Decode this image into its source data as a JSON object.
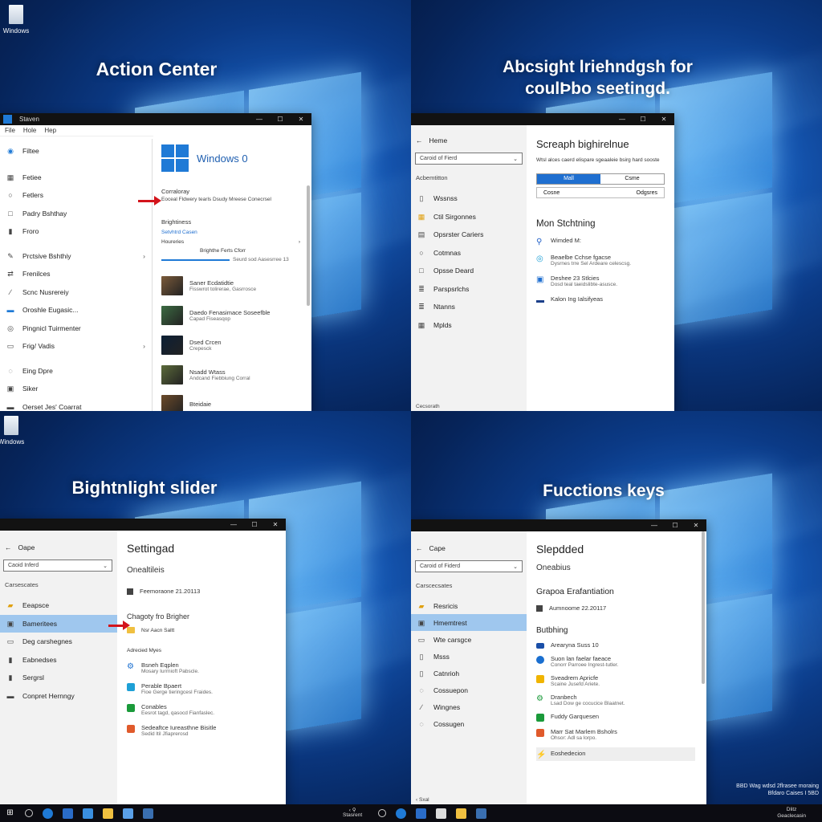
{
  "q1": {
    "title": "Action Center",
    "desktop_icon": "Windows",
    "window": {
      "title": "Staven",
      "menu": [
        "File",
        "Hole",
        "Hep"
      ],
      "left_items": [
        {
          "label": "Filtee",
          "icon": "circle-check-icon"
        },
        {
          "label": "Fetiee",
          "icon": "grid-icon"
        },
        {
          "label": "Fetlers",
          "icon": "circle-icon"
        },
        {
          "label": "Padry Bshthay",
          "icon": "square-icon"
        },
        {
          "label": "Froro",
          "icon": "bookmark-icon"
        },
        {
          "label": "Prctsive Bshthiy",
          "icon": "pen-icon",
          "chevron": "›"
        },
        {
          "label": "Frenilces",
          "icon": "link-icon"
        },
        {
          "label": "Scnc Nusrereiy",
          "icon": "wand-icon"
        },
        {
          "label": "Oroshle Eugasic...",
          "icon": "bar-icon"
        },
        {
          "label": "Pingnicl Tuirmenter",
          "icon": "target-icon"
        },
        {
          "label": "Frig/ Vadis",
          "icon": "display-icon",
          "chevron": "›"
        },
        {
          "label": "Eing Dpre",
          "icon": "circle-icon"
        },
        {
          "label": "Siker",
          "icon": "monitor-icon"
        },
        {
          "label": "Oerset Jes' Coarrat",
          "icon": "bar-icon"
        }
      ],
      "brand": "Windows 0",
      "group1_title": "Corraloray",
      "group1_sub": "Eoceal Fldwery tearls Dsudy Mreese Conecrsel",
      "group2_title": "Brightiness",
      "group2_link": "Setvhtrd Casen",
      "group2_sub": "Houreries",
      "slider_title": "Brighthe Ferts Cforr",
      "slider_value": "Seurd sod Aasesrree 13",
      "apps": [
        {
          "title": "Saner Ecdatidtie",
          "sub": "Fisswrot tolirerae, Gasrrosce",
          "color": "#7b5a3a"
        },
        {
          "title": "Daedo Fenasimace Soseefble",
          "sub": "Capad Fiseasqop",
          "color": "#3c6b42"
        },
        {
          "title": "Dsed Crcen",
          "sub": "Crepesck",
          "color": "#0c1f35"
        },
        {
          "title": "Nsadd Wtass",
          "sub": "Andcand Fiebbiung Corral",
          "color": "#5b6a3a"
        },
        {
          "title": "Bteidaie",
          "sub": "",
          "color": "#6b4a2a"
        }
      ]
    }
  },
  "q2": {
    "title_line1": "Abcsight lriehndgsh for",
    "title_line2": "coulÞbo seetingd.",
    "window": {
      "back": "Heme",
      "search_placeholder": "Caroid of Fierd",
      "section": "Acbemtitton",
      "left_items": [
        {
          "label": "Wssnss",
          "icon": "doc-icon"
        },
        {
          "label": "Ctil Sirgonnes",
          "icon": "color-grid-icon"
        },
        {
          "label": "Opsrster Cariers",
          "icon": "calc-icon"
        },
        {
          "label": "Cotmnas",
          "icon": "circle-icon"
        },
        {
          "label": "Opsse Deard",
          "icon": "square-icon"
        },
        {
          "label": "Parspsrlchs",
          "icon": "list-icon"
        },
        {
          "label": "Ntanns",
          "icon": "list-icon"
        },
        {
          "label": "Mplds",
          "icon": "grid-icon"
        }
      ],
      "bottom_label": "Cecsorath",
      "heading": "Screaph bighirelnue",
      "description": "Wtsl alces caerd elispare sgeaaleie bsirg hard sooste",
      "toggle_on": "Mall",
      "toggle_off": "Csme",
      "field_left": "Cosne",
      "field_right": "Odgsres",
      "heading2": "Mon Stchtning",
      "subitems": [
        {
          "title": "Wimded M:",
          "sub": "",
          "color": "#1f5fc7",
          "icon": "pin-icon"
        },
        {
          "title": "Beaelbe Cchse fgacse",
          "sub": "Dysrnes trre Sel Ardeare celescsg.",
          "color": "#1ea0d6",
          "icon": "circle-icon"
        },
        {
          "title": "Deshee 23 Stlcies",
          "sub": "Dosd teal taeidslibte-asusce.",
          "color": "#1f6fd0",
          "icon": "square-icon"
        },
        {
          "title": "Kalon Ing Ialsifyeas",
          "sub": "",
          "color": "#1b3f8a",
          "icon": "bar-icon"
        }
      ]
    }
  },
  "q3": {
    "title": "Bightnlight slider",
    "desktop_icon": "Windows",
    "window": {
      "back": "Oape",
      "search_placeholder": "Caoid Inferd",
      "section": "Carsescates",
      "left_items": [
        {
          "label": "Eeapsce",
          "icon": "folder-icon",
          "selected": false
        },
        {
          "label": "Bameritees",
          "icon": "monitor-icon",
          "selected": true
        },
        {
          "label": "Deg carshegnes",
          "icon": "display-icon",
          "selected": false
        },
        {
          "label": "Eabnedses",
          "icon": "bookmark-icon",
          "selected": false
        },
        {
          "label": "Sergrsl",
          "icon": "bookmark-icon",
          "selected": false
        },
        {
          "label": "Conpret Hernngy",
          "icon": "bar-icon",
          "selected": false
        }
      ],
      "heading": "Settingad",
      "subheading": "Onealtileis",
      "row1": "Feemoraone 21.20113",
      "group_title": "Chagoty fro Brigher",
      "group_sub": "Nsr Aacn Saltt",
      "section2": "Adrecied Myes",
      "subitems": [
        {
          "title": "Bsneh Eqplen",
          "sub": "Mosary Iurrnioft Pabscle.",
          "color": "#1a6fd0",
          "icon": "gear-icon"
        },
        {
          "title": "Perable Bpaert",
          "sub": "Fioe Gerge tieringcesl Fraides.",
          "color": "#1ea0d6",
          "icon": "square-icon"
        },
        {
          "title": "Conables",
          "sub": "Eesrot tagd, qasocd Fianfaslec.",
          "color": "#1a9a3a",
          "icon": "grid-icon"
        },
        {
          "title": "Sedeaftce Iureasthne Bisitle",
          "sub": "Sedid ltil Jfiaprerosd",
          "color": "#e05a2b",
          "icon": "square-icon"
        }
      ]
    }
  },
  "q4": {
    "title": "Fucctions keys",
    "watermark_line1": "BBD Wag wdsd 2flrasee moraing",
    "watermark_line2": "Bfdaro Caises I 5BD",
    "window": {
      "back": "Cape",
      "search_placeholder": "Caroid of Fiderd",
      "section": "Carscecsates",
      "left_items": [
        {
          "label": "Resricis",
          "icon": "folder-icon",
          "selected": false
        },
        {
          "label": "Hmemtrest",
          "icon": "monitor-icon",
          "selected": true
        },
        {
          "label": "Wte carsgce",
          "icon": "display-icon",
          "selected": false
        },
        {
          "label": "Msss",
          "icon": "doc-icon",
          "selected": false
        },
        {
          "label": "Catnrioh",
          "icon": "doc-icon",
          "selected": false
        },
        {
          "label": "Cossuepon",
          "icon": "circle-icon",
          "selected": false
        },
        {
          "label": "Wingnes",
          "icon": "wand-icon",
          "selected": false
        },
        {
          "label": "Cossugen",
          "icon": "circle-icon",
          "selected": false
        }
      ],
      "bottom_label": "Sxal",
      "heading": "Slepdded",
      "subheading": "Oneabius",
      "heading2": "Grapoa Erafantiation",
      "row1": "Aumnoome 22.20117",
      "section2": "Butbhing",
      "subitems": [
        {
          "title": "Arearyna Suss 10",
          "sub": "",
          "color": "#1a4fa8",
          "icon": "bar-icon"
        },
        {
          "title": "Suon lan faelar faeace",
          "sub": "Conorr Parroee Ingrest-tutler.",
          "color": "#1a6fd0",
          "icon": "circle-icon"
        },
        {
          "title": "Sveadrem Apricfe",
          "sub": "Scaine Jusefd Ariete.",
          "color": "#f0b400",
          "icon": "square-icon"
        },
        {
          "title": "Dranbech",
          "sub": "Lsad Dow ge cocucice Blaatnet.",
          "color": "#1a9a3a",
          "icon": "gear-icon"
        },
        {
          "title": "Fuddy Garquesen",
          "sub": "",
          "color": "#1a9a3a",
          "icon": "doc-icon"
        },
        {
          "title": "Marr Sat Marlem Bsholrs",
          "sub": "Ohsor: Adl sa lorpo.",
          "color": "#e05a2b",
          "icon": "square-icon"
        },
        {
          "title": "Eoshedecion",
          "sub": "",
          "color": "#d3141b",
          "icon": "bolt-icon"
        }
      ]
    }
  },
  "taskbar": {
    "left_icons": [
      "start-icon",
      "search-icon",
      "edge-icon",
      "folder-icon",
      "store-icon",
      "mail-icon",
      "photos-icon",
      "settings-icon"
    ],
    "mid_label": "Stasrent",
    "right_icons": [
      "search-icon",
      "edge-icon",
      "folder-icon",
      "store-icon",
      "mail-icon",
      "settings-icon"
    ],
    "tray_text_line1": "Dlitz",
    "tray_text_line2": "Geaclecasin"
  }
}
